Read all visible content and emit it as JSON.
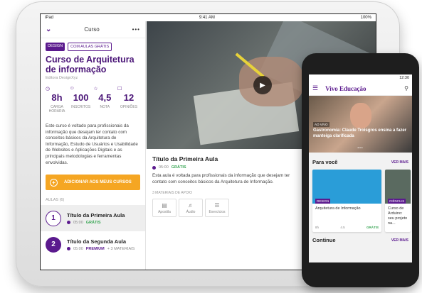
{
  "tablet": {
    "status": {
      "left": "iPad",
      "time": "9:41 AM",
      "battery": "100%"
    },
    "topbar": {
      "title": "Curso"
    },
    "tags": [
      "DESIGN",
      "COM AULAS GRÁTIS"
    ],
    "course": {
      "title": "Curso de Arquitetura de informação",
      "author": "Editora DesignXyz",
      "description": "Este curso é voltado para profissionais da informação que desejam ter contato com conceitos básicos da Arquitetura de Informação, Estudo de Usuários e Usabilidade de Websites e Aplicações Digitais e as principais metodologias e ferramentas envolvidas."
    },
    "stats": [
      {
        "value": "8h",
        "label": "CARGA HORÁRIA",
        "icon": "clock-icon"
      },
      {
        "value": "100",
        "label": "INSCRITOS",
        "icon": "person-icon"
      },
      {
        "value": "4,5",
        "label": "NOTA",
        "icon": "star-icon"
      },
      {
        "value": "12",
        "label": "OPINIÕES",
        "icon": "comment-icon"
      }
    ],
    "add_button": "ADICIONAR AOS MEUS CURSOS",
    "lessons_header": "AULAS (6)",
    "lessons": [
      {
        "num": "1",
        "title": "Título da Primeira Aula",
        "duration": "05:00",
        "price": "GRÁTIS",
        "extra": ""
      },
      {
        "num": "2",
        "title": "Título da Segunda Aula",
        "duration": "05:00",
        "price": "PREMIUM",
        "extra": "+ 3 MATERIAIS"
      }
    ],
    "video": {
      "title": "Título da Primeira Aula",
      "duration": "05:00",
      "price": "GRÁTIS",
      "description": "Esta aula é voltada para profissionais da informação que desejam ter contato com conceitos básicos da Arquitetura de Informação.",
      "materials_header": "3 MATERIAIS DE APOIO",
      "materials": [
        "Apostila",
        "Áudio",
        "Exercícios"
      ]
    }
  },
  "phone": {
    "status": {
      "time": "12:30"
    },
    "app_title": "Vivo Educação",
    "hero": {
      "live": "AO VIVO",
      "title": "Gastronomia: Claude Troisgros ensina a fazer manteiga clarificada"
    },
    "section1": {
      "title": "Para você",
      "more": "VER MAIS"
    },
    "cards": [
      {
        "badge": "DESIGN",
        "title": "Arquitetura de Informação",
        "hours": "8h",
        "rating": "4.5",
        "price": "GRÁTIS"
      },
      {
        "badge": "CIÊNCIAS",
        "title": "Curso de Arduino: seu projeto na...",
        "hours": "",
        "rating": "",
        "price": ""
      }
    ],
    "section2": {
      "title": "Continue",
      "more": "VER MAIS"
    }
  }
}
